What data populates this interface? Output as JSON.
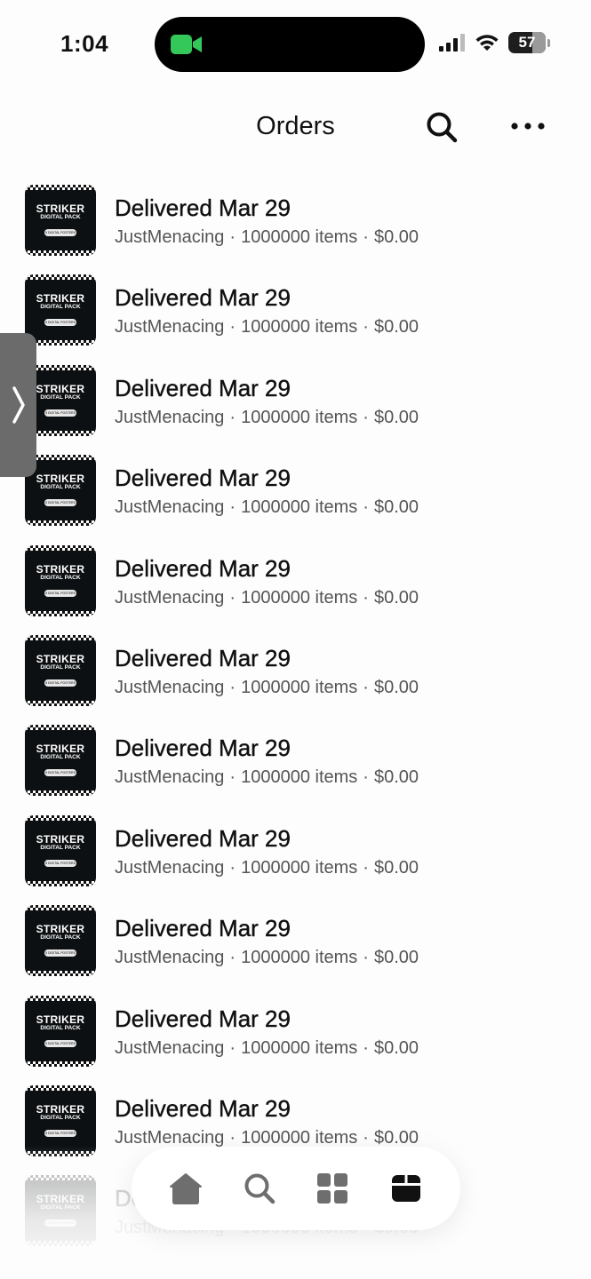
{
  "status_bar": {
    "time": "1:04",
    "battery": "57",
    "icons": [
      "facetime-video-icon",
      "cellular-signal-icon",
      "wifi-icon",
      "battery-icon"
    ],
    "facetime_color": "#34c759"
  },
  "nav": {
    "title": "Orders",
    "search_icon": "search-icon",
    "more_icon": "more-horizontal-icon"
  },
  "orders": [
    {
      "title": "Delivered Mar 29",
      "seller": "JustMenacing",
      "items": "1000000 items",
      "price": "$0.00",
      "thumb": {
        "title": "STRIKER",
        "subtitle": "DIGITAL PACK",
        "badge": "5 DIGITAL POSTERS"
      }
    },
    {
      "title": "Delivered Mar 29",
      "seller": "JustMenacing",
      "items": "1000000 items",
      "price": "$0.00",
      "thumb": {
        "title": "STRIKER",
        "subtitle": "DIGITAL PACK",
        "badge": "5 DIGITAL POSTERS"
      }
    },
    {
      "title": "Delivered Mar 29",
      "seller": "JustMenacing",
      "items": "1000000 items",
      "price": "$0.00",
      "thumb": {
        "title": "STRIKER",
        "subtitle": "DIGITAL PACK",
        "badge": "5 DIGITAL POSTERS"
      }
    },
    {
      "title": "Delivered Mar 29",
      "seller": "JustMenacing",
      "items": "1000000 items",
      "price": "$0.00",
      "thumb": {
        "title": "STRIKER",
        "subtitle": "DIGITAL PACK",
        "badge": "5 DIGITAL POSTERS"
      }
    },
    {
      "title": "Delivered Mar 29",
      "seller": "JustMenacing",
      "items": "1000000 items",
      "price": "$0.00",
      "thumb": {
        "title": "STRIKER",
        "subtitle": "DIGITAL PACK",
        "badge": "5 DIGITAL POSTERS"
      }
    },
    {
      "title": "Delivered Mar 29",
      "seller": "JustMenacing",
      "items": "1000000 items",
      "price": "$0.00",
      "thumb": {
        "title": "STRIKER",
        "subtitle": "DIGITAL PACK",
        "badge": "5 DIGITAL POSTERS"
      }
    },
    {
      "title": "Delivered Mar 29",
      "seller": "JustMenacing",
      "items": "1000000 items",
      "price": "$0.00",
      "thumb": {
        "title": "STRIKER",
        "subtitle": "DIGITAL PACK",
        "badge": "5 DIGITAL POSTERS"
      }
    },
    {
      "title": "Delivered Mar 29",
      "seller": "JustMenacing",
      "items": "1000000 items",
      "price": "$0.00",
      "thumb": {
        "title": "STRIKER",
        "subtitle": "DIGITAL PACK",
        "badge": "5 DIGITAL POSTERS"
      }
    },
    {
      "title": "Delivered Mar 29",
      "seller": "JustMenacing",
      "items": "1000000 items",
      "price": "$0.00",
      "thumb": {
        "title": "STRIKER",
        "subtitle": "DIGITAL PACK",
        "badge": "5 DIGITAL POSTERS"
      }
    },
    {
      "title": "Delivered Mar 29",
      "seller": "JustMenacing",
      "items": "1000000 items",
      "price": "$0.00",
      "thumb": {
        "title": "STRIKER",
        "subtitle": "DIGITAL PACK",
        "badge": "5 DIGITAL POSTERS"
      }
    },
    {
      "title": "Delivered Mar 29",
      "seller": "JustMenacing",
      "items": "1000000 items",
      "price": "$0.00",
      "thumb": {
        "title": "STRIKER",
        "subtitle": "DIGITAL PACK",
        "badge": "5 DIGITAL POSTERS"
      }
    },
    {
      "title": "Delivered Mar 29",
      "seller": "JustMenacing",
      "items": "1000000 items",
      "price": "$0.00",
      "thumb": {
        "title": "STRIKER",
        "subtitle": "DIGITAL PACK",
        "badge": "5 DIGITAL POSTERS"
      }
    }
  ],
  "separator": "·",
  "side_handle": {
    "icon": "chevron-right-icon"
  },
  "tab_bar": {
    "tabs": [
      {
        "icon": "home-icon",
        "active": false
      },
      {
        "icon": "search-icon",
        "active": false
      },
      {
        "icon": "grid-icon",
        "active": false
      },
      {
        "icon": "orders-box-icon",
        "active": true
      }
    ],
    "inactive_color": "#6e6e6e",
    "active_color": "#111111"
  }
}
